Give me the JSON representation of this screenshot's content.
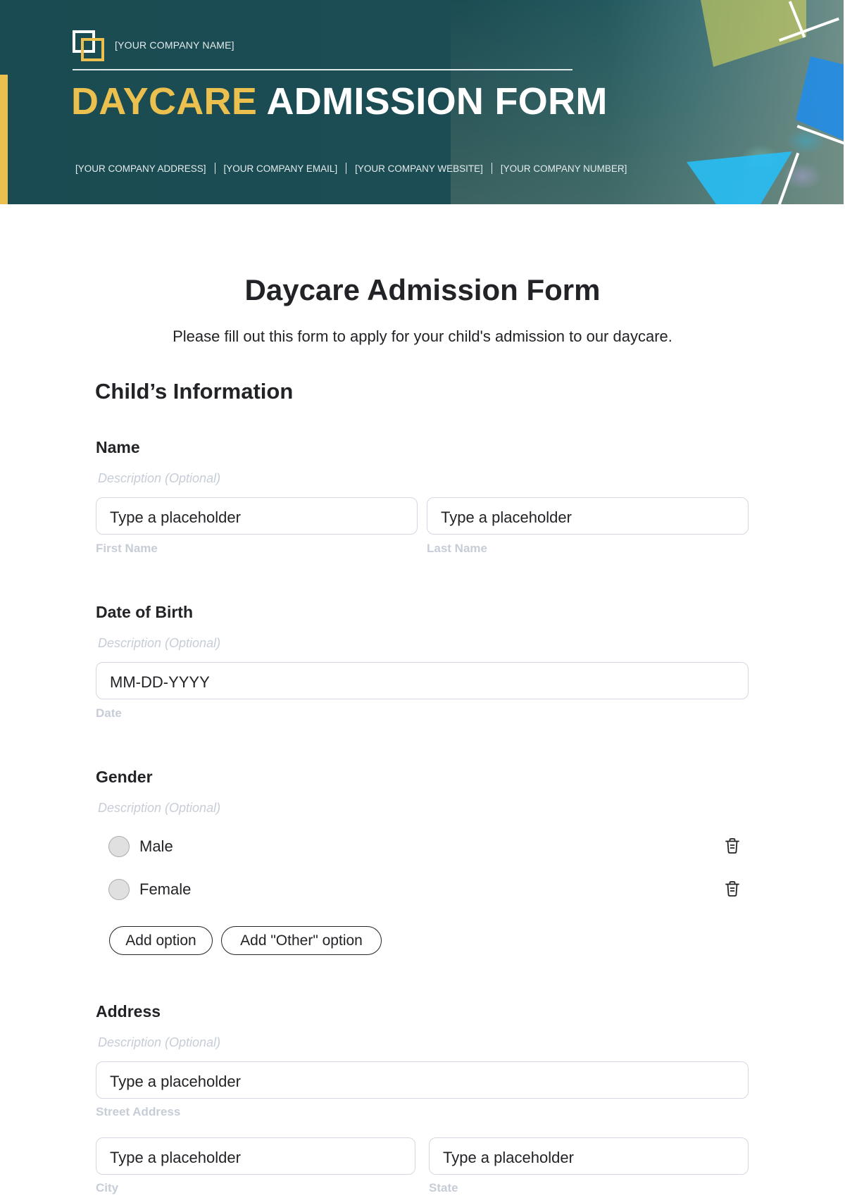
{
  "header": {
    "company_name": "[YOUR COMPANY NAME]",
    "title_highlight": "DAYCARE",
    "title_rest": "ADMISSION FORM",
    "contacts": [
      "[YOUR COMPANY ADDRESS]",
      "[YOUR COMPANY EMAIL]",
      "[YOUR COMPANY WEBSITE]",
      "[YOUR COMPANY NUMBER]"
    ],
    "colors": {
      "banner": "#1b4b52",
      "accent": "#ecc04f"
    }
  },
  "form": {
    "title": "Daycare Admission Form",
    "subtitle": "Please fill out this form to apply for your child's admission to our daycare.",
    "section_title": "Child’s Information",
    "questions": {
      "name": {
        "label": "Name",
        "description": "Description (Optional)",
        "fields": [
          {
            "placeholder": "Type a placeholder",
            "sublabel": "First Name"
          },
          {
            "placeholder": "Type a placeholder",
            "sublabel": "Last Name"
          }
        ]
      },
      "dob": {
        "label": "Date of Birth",
        "description": "Description (Optional)",
        "placeholder": "MM-DD-YYYY",
        "sublabel": "Date"
      },
      "gender": {
        "label": "Gender",
        "description": "Description (Optional)",
        "options": [
          "Male",
          "Female"
        ],
        "add_option_label": "Add option",
        "add_other_label": "Add \"Other\" option"
      },
      "address": {
        "label": "Address",
        "description": "Description (Optional)",
        "street": {
          "placeholder": "Type a placeholder",
          "sublabel": "Street Address"
        },
        "city": {
          "placeholder": "Type a placeholder",
          "sublabel": "City"
        },
        "state": {
          "placeholder": "Type a placeholder",
          "sublabel": "State"
        }
      }
    }
  }
}
